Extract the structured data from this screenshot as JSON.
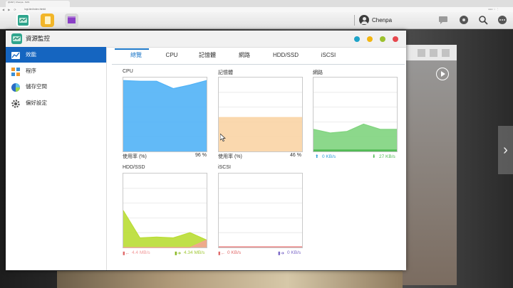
{
  "browser": {
    "tab_title": "QNAP | Chenpa - NAS",
    "url": "/cgi-bin/index.html#",
    "nav_glyphs": "◀ ▶ ⟳",
    "ext_text": "●●● ☆ ⋮"
  },
  "topbar": {
    "username": "Chenpa",
    "apps": [
      {
        "name": "resource-monitor-app",
        "color": "#2fa58d"
      },
      {
        "name": "notes-app",
        "color": "#f2b629"
      },
      {
        "name": "video-app",
        "color": "#8a3fc6"
      }
    ]
  },
  "window": {
    "title": "資源監控",
    "controls": {
      "info": "#1ea3c8",
      "minimize": "#f2b50f",
      "maximize": "#9cc12e",
      "close": "#e6474d"
    }
  },
  "sidebar": {
    "items": [
      {
        "label": "效能",
        "icon": "performance-chart-icon",
        "active": true
      },
      {
        "label": "程序",
        "icon": "process-icon",
        "active": false
      },
      {
        "label": "儲存空間",
        "icon": "storage-pie-icon",
        "active": false
      },
      {
        "label": "偏好設定",
        "icon": "gear-icon",
        "active": false
      }
    ]
  },
  "tabs": [
    {
      "label": "總覽",
      "active": true
    },
    {
      "label": "CPU",
      "active": false
    },
    {
      "label": "記憶體",
      "active": false
    },
    {
      "label": "網路",
      "active": false
    },
    {
      "label": "HDD/SSD",
      "active": false
    },
    {
      "label": "iSCSI",
      "active": false
    }
  ],
  "panels": {
    "cpu": {
      "title": "CPU",
      "usage_label": "使用率 (%)",
      "value": "96 %"
    },
    "memory": {
      "title": "記憶體",
      "usage_label": "使用率 (%)",
      "value": "46 %"
    },
    "network": {
      "title": "網路",
      "upload": "0 KB/s",
      "download": "27 KB/s"
    },
    "hdd": {
      "title": "HDD/SSD",
      "read": "4.4 MB/s",
      "write": "4.34 MB/s"
    },
    "iscsi": {
      "title": "iSCSI",
      "read": "0 KB/s",
      "write": "0 KB/s"
    }
  },
  "chart_data": [
    {
      "type": "area",
      "name": "CPU",
      "ylim": [
        0,
        100
      ],
      "values": [
        96,
        95,
        95,
        85,
        90,
        96
      ],
      "color": "#51b2f6"
    },
    {
      "type": "area",
      "name": "記憶體",
      "ylim": [
        0,
        100
      ],
      "values": [
        46,
        46,
        46,
        46,
        46,
        46
      ],
      "color": "#fad4a5"
    },
    {
      "type": "area",
      "name": "網路",
      "ylim": [
        0,
        100
      ],
      "series": [
        {
          "values": [
            30,
            25,
            27,
            37,
            30,
            30
          ],
          "color": "#80d47e"
        },
        {
          "values": [
            2,
            2,
            2,
            2,
            2,
            2
          ],
          "color": "#4eb852"
        }
      ]
    },
    {
      "type": "area",
      "name": "HDD/SSD",
      "ylim": [
        0,
        100
      ],
      "series": [
        {
          "values": [
            50,
            13,
            14,
            13,
            20,
            10
          ],
          "color": "#b9dd34"
        },
        {
          "values": [
            0,
            0,
            0,
            0,
            0,
            10
          ],
          "color": "#f2a592"
        }
      ]
    },
    {
      "type": "area",
      "name": "iSCSI",
      "ylim": [
        0,
        100
      ],
      "series": [
        {
          "values": [
            1,
            1,
            1,
            1,
            1,
            1
          ],
          "color": "#e98a8a"
        }
      ]
    }
  ]
}
